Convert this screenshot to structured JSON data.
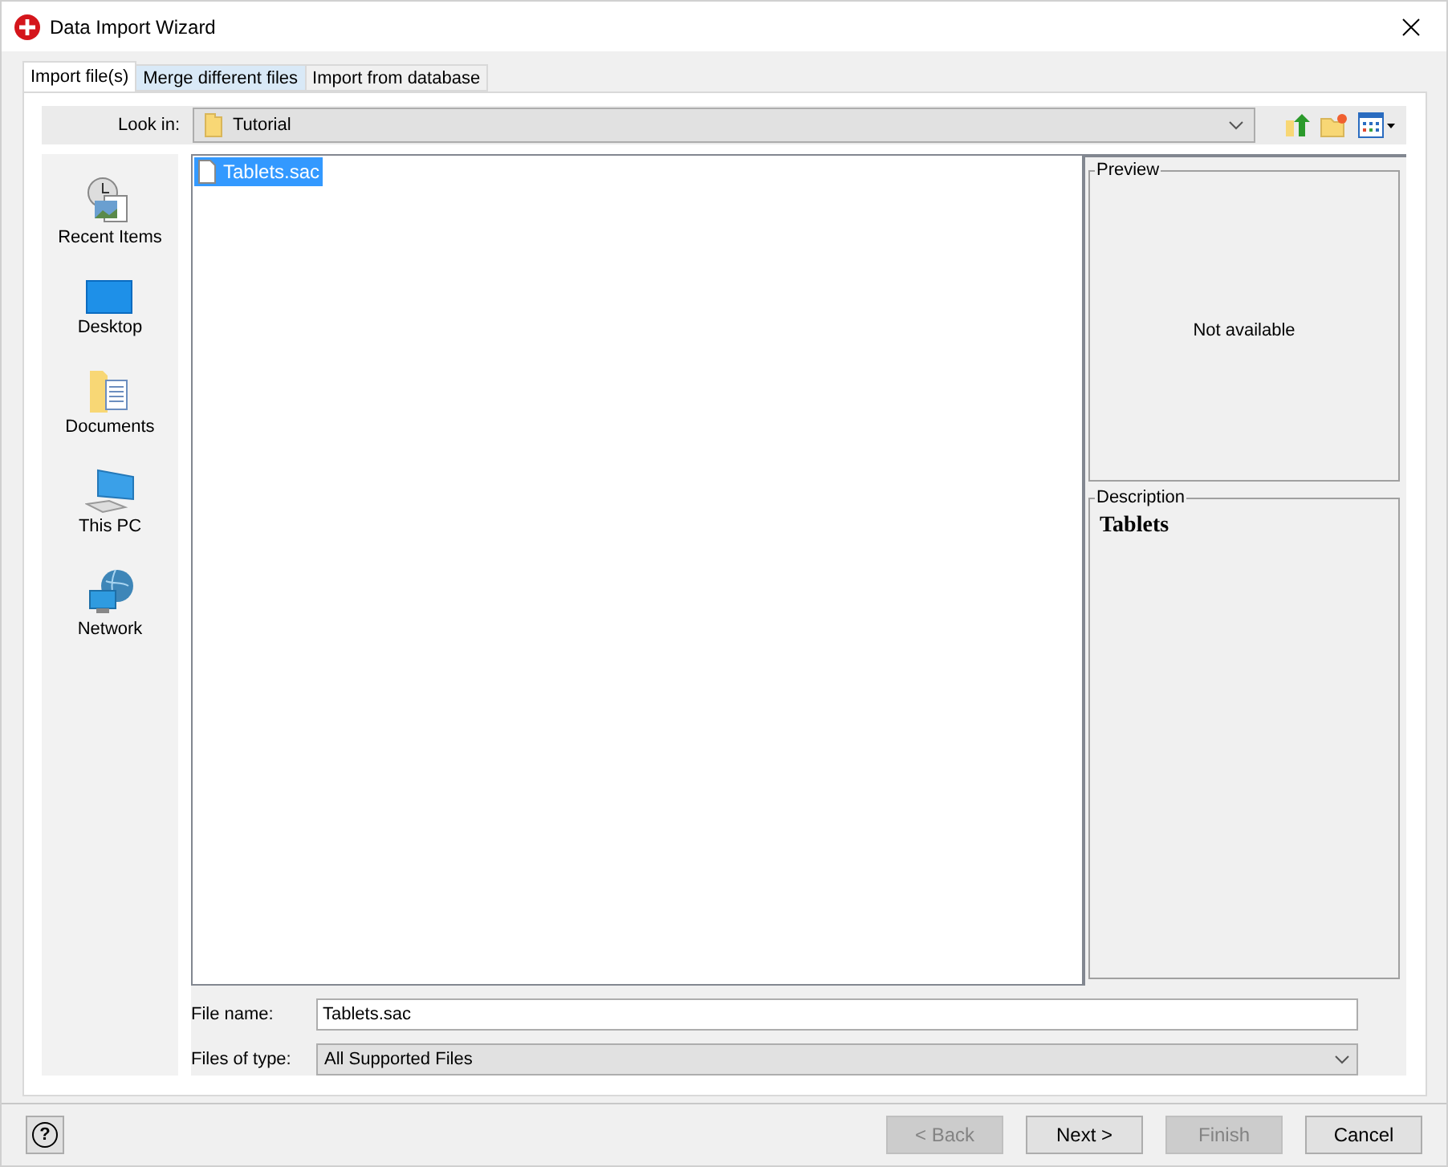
{
  "window": {
    "title": "Data Import Wizard"
  },
  "tabs": [
    {
      "label": "Import file(s)",
      "selected": true
    },
    {
      "label": "Merge different files",
      "selected": false
    },
    {
      "label": "Import from database",
      "selected": false
    }
  ],
  "look_in": {
    "label": "Look in:",
    "value": "Tutorial"
  },
  "places": [
    {
      "kind": "recent",
      "label": "Recent Items"
    },
    {
      "kind": "desktop",
      "label": "Desktop"
    },
    {
      "kind": "documents",
      "label": "Documents"
    },
    {
      "kind": "pc",
      "label": "This PC"
    },
    {
      "kind": "network",
      "label": "Network"
    }
  ],
  "files": [
    {
      "name": "Tablets.sac",
      "selected": true
    }
  ],
  "preview": {
    "title": "Preview",
    "text": "Not available"
  },
  "description": {
    "title": "Description",
    "text": "Tablets"
  },
  "file_name": {
    "label": "File name:",
    "value": "Tablets.sac"
  },
  "file_type": {
    "label": "Files of type:",
    "value": "All Supported Files"
  },
  "help": {
    "label": "?"
  },
  "buttons": [
    {
      "label": "< Back",
      "disabled": true
    },
    {
      "label": "Next >",
      "disabled": false
    },
    {
      "label": "Finish",
      "disabled": true
    },
    {
      "label": "Cancel",
      "disabled": false
    }
  ]
}
